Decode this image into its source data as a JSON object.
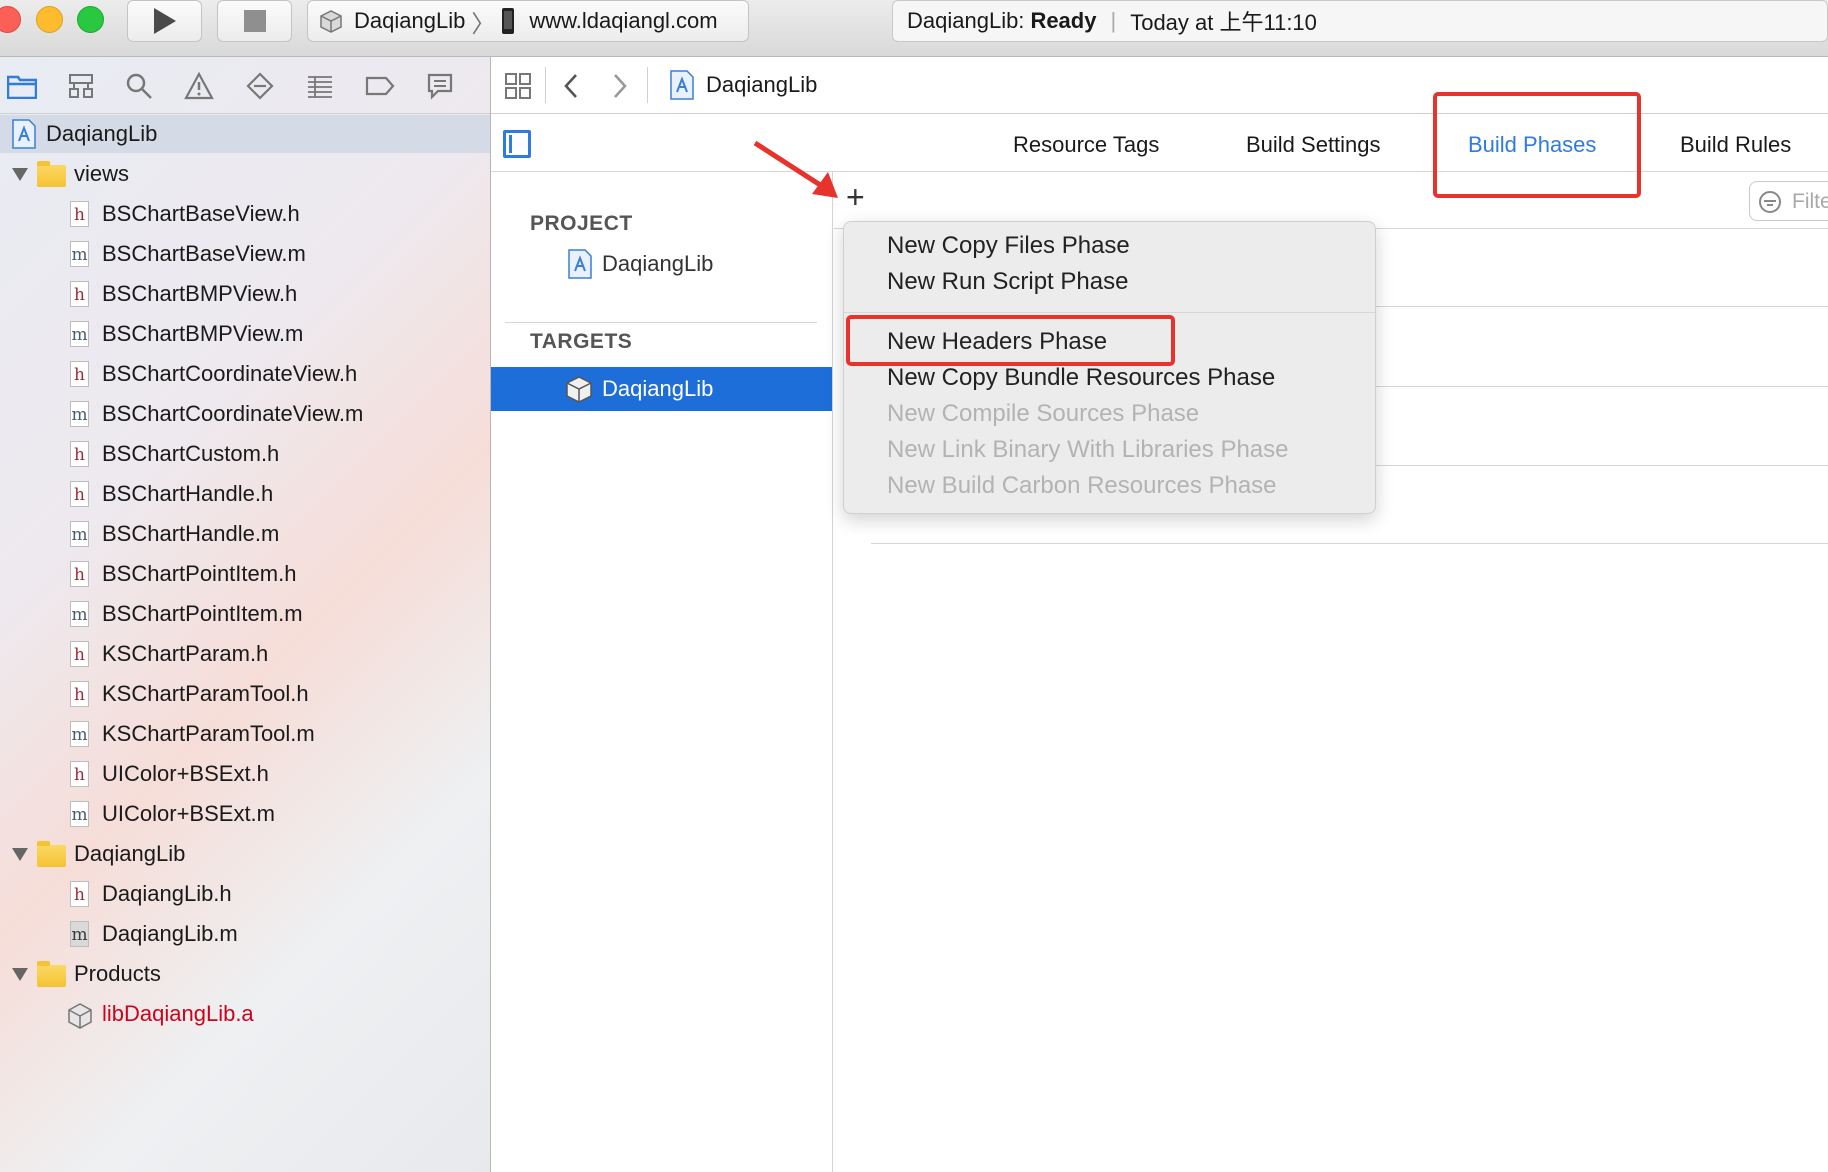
{
  "window": {
    "scheme_project": "DaqiangLib",
    "scheme_destination": "www.ldaqiangl.com",
    "activity_project": "DaqiangLib:",
    "activity_status": "Ready",
    "activity_time": "Today at 上午11:10"
  },
  "navigator": {
    "project_name": "DaqiangLib",
    "items": [
      {
        "label": "views",
        "type": "folder"
      },
      {
        "label": "BSChartBaseView.h",
        "type": "h"
      },
      {
        "label": "BSChartBaseView.m",
        "type": "m"
      },
      {
        "label": "BSChartBMPView.h",
        "type": "h"
      },
      {
        "label": "BSChartBMPView.m",
        "type": "m"
      },
      {
        "label": "BSChartCoordinateView.h",
        "type": "h"
      },
      {
        "label": "BSChartCoordinateView.m",
        "type": "m"
      },
      {
        "label": "BSChartCustom.h",
        "type": "h"
      },
      {
        "label": "BSChartHandle.h",
        "type": "h"
      },
      {
        "label": "BSChartHandle.m",
        "type": "m"
      },
      {
        "label": "BSChartPointItem.h",
        "type": "h"
      },
      {
        "label": "BSChartPointItem.m",
        "type": "m"
      },
      {
        "label": "KSChartParam.h",
        "type": "h"
      },
      {
        "label": "KSChartParamTool.h",
        "type": "h"
      },
      {
        "label": "KSChartParamTool.m",
        "type": "m"
      },
      {
        "label": "UIColor+BSExt.h",
        "type": "h"
      },
      {
        "label": "UIColor+BSExt.m",
        "type": "m"
      },
      {
        "label": "DaqiangLib",
        "type": "folder"
      },
      {
        "label": "DaqiangLib.h",
        "type": "h"
      },
      {
        "label": "DaqiangLib.m",
        "type": "m"
      },
      {
        "label": "Products",
        "type": "folder"
      },
      {
        "label": "libDaqiangLib.a",
        "type": "lib"
      }
    ]
  },
  "editor": {
    "breadcrumb": "DaqiangLib",
    "tabs": {
      "resource_tags": "Resource Tags",
      "build_settings": "Build Settings",
      "build_phases": "Build Phases",
      "build_rules": "Build Rules"
    },
    "filter_placeholder": "Filte",
    "outline": {
      "project_header": "PROJECT",
      "project_item": "DaqiangLib",
      "targets_header": "TARGETS",
      "target_item": "DaqiangLib"
    },
    "add_symbol": "+"
  },
  "menu": {
    "items": [
      {
        "label": "New Copy Files Phase",
        "enabled": true
      },
      {
        "label": "New Run Script Phase",
        "enabled": true
      },
      {
        "label": "New Headers Phase",
        "enabled": true
      },
      {
        "label": "New Copy Bundle Resources Phase",
        "enabled": true
      },
      {
        "label": "New Compile Sources Phase",
        "enabled": false
      },
      {
        "label": "New Link Binary With Libraries Phase",
        "enabled": false
      },
      {
        "label": "New Build Carbon Resources Phase",
        "enabled": false
      }
    ]
  },
  "colors": {
    "accent": "#2f7be0",
    "selection": "#1d6ed9",
    "annotation_red": "#e8332c",
    "product_red": "#d0021b"
  }
}
